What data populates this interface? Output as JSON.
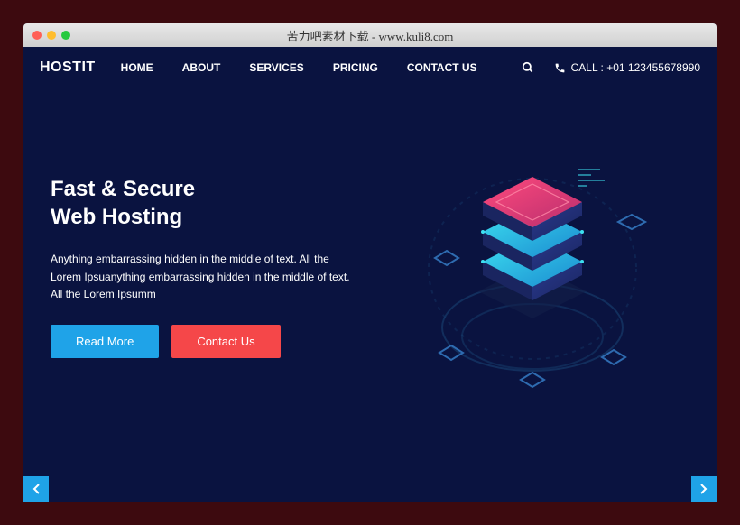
{
  "browser": {
    "title": "苦力吧素材下载 - www.kuli8.com"
  },
  "navbar": {
    "logo": "HOSTIT",
    "menu": [
      "HOME",
      "ABOUT",
      "SERVICES",
      "PRICING",
      "CONTACT US"
    ],
    "call_label": "CALL : +01 123455678990"
  },
  "hero": {
    "title_line1": "Fast & Secure",
    "title_line2": "Web Hosting",
    "description": "Anything embarrassing hidden in the middle of text. All the Lorem Ipsuanything embarrassing hidden in the middle of text. All the Lorem Ipsumm",
    "btn_read_more": "Read More",
    "btn_contact": "Contact Us"
  }
}
